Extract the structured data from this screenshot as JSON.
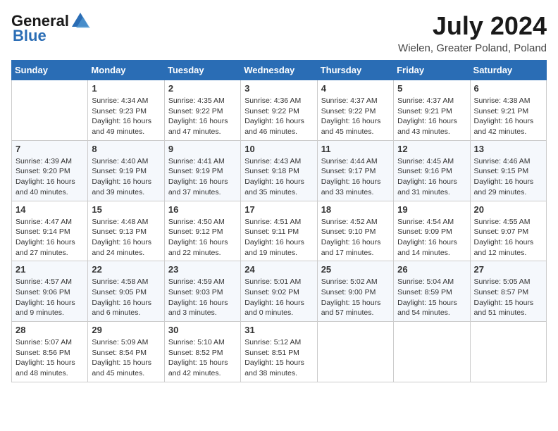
{
  "header": {
    "logo_general": "General",
    "logo_blue": "Blue",
    "month_year": "July 2024",
    "location": "Wielen, Greater Poland, Poland"
  },
  "weekdays": [
    "Sunday",
    "Monday",
    "Tuesday",
    "Wednesday",
    "Thursday",
    "Friday",
    "Saturday"
  ],
  "weeks": [
    [
      {
        "day": "",
        "content": ""
      },
      {
        "day": "1",
        "content": "Sunrise: 4:34 AM\nSunset: 9:23 PM\nDaylight: 16 hours\nand 49 minutes."
      },
      {
        "day": "2",
        "content": "Sunrise: 4:35 AM\nSunset: 9:22 PM\nDaylight: 16 hours\nand 47 minutes."
      },
      {
        "day": "3",
        "content": "Sunrise: 4:36 AM\nSunset: 9:22 PM\nDaylight: 16 hours\nand 46 minutes."
      },
      {
        "day": "4",
        "content": "Sunrise: 4:37 AM\nSunset: 9:22 PM\nDaylight: 16 hours\nand 45 minutes."
      },
      {
        "day": "5",
        "content": "Sunrise: 4:37 AM\nSunset: 9:21 PM\nDaylight: 16 hours\nand 43 minutes."
      },
      {
        "day": "6",
        "content": "Sunrise: 4:38 AM\nSunset: 9:21 PM\nDaylight: 16 hours\nand 42 minutes."
      }
    ],
    [
      {
        "day": "7",
        "content": "Sunrise: 4:39 AM\nSunset: 9:20 PM\nDaylight: 16 hours\nand 40 minutes."
      },
      {
        "day": "8",
        "content": "Sunrise: 4:40 AM\nSunset: 9:19 PM\nDaylight: 16 hours\nand 39 minutes."
      },
      {
        "day": "9",
        "content": "Sunrise: 4:41 AM\nSunset: 9:19 PM\nDaylight: 16 hours\nand 37 minutes."
      },
      {
        "day": "10",
        "content": "Sunrise: 4:43 AM\nSunset: 9:18 PM\nDaylight: 16 hours\nand 35 minutes."
      },
      {
        "day": "11",
        "content": "Sunrise: 4:44 AM\nSunset: 9:17 PM\nDaylight: 16 hours\nand 33 minutes."
      },
      {
        "day": "12",
        "content": "Sunrise: 4:45 AM\nSunset: 9:16 PM\nDaylight: 16 hours\nand 31 minutes."
      },
      {
        "day": "13",
        "content": "Sunrise: 4:46 AM\nSunset: 9:15 PM\nDaylight: 16 hours\nand 29 minutes."
      }
    ],
    [
      {
        "day": "14",
        "content": "Sunrise: 4:47 AM\nSunset: 9:14 PM\nDaylight: 16 hours\nand 27 minutes."
      },
      {
        "day": "15",
        "content": "Sunrise: 4:48 AM\nSunset: 9:13 PM\nDaylight: 16 hours\nand 24 minutes."
      },
      {
        "day": "16",
        "content": "Sunrise: 4:50 AM\nSunset: 9:12 PM\nDaylight: 16 hours\nand 22 minutes."
      },
      {
        "day": "17",
        "content": "Sunrise: 4:51 AM\nSunset: 9:11 PM\nDaylight: 16 hours\nand 19 minutes."
      },
      {
        "day": "18",
        "content": "Sunrise: 4:52 AM\nSunset: 9:10 PM\nDaylight: 16 hours\nand 17 minutes."
      },
      {
        "day": "19",
        "content": "Sunrise: 4:54 AM\nSunset: 9:09 PM\nDaylight: 16 hours\nand 14 minutes."
      },
      {
        "day": "20",
        "content": "Sunrise: 4:55 AM\nSunset: 9:07 PM\nDaylight: 16 hours\nand 12 minutes."
      }
    ],
    [
      {
        "day": "21",
        "content": "Sunrise: 4:57 AM\nSunset: 9:06 PM\nDaylight: 16 hours\nand 9 minutes."
      },
      {
        "day": "22",
        "content": "Sunrise: 4:58 AM\nSunset: 9:05 PM\nDaylight: 16 hours\nand 6 minutes."
      },
      {
        "day": "23",
        "content": "Sunrise: 4:59 AM\nSunset: 9:03 PM\nDaylight: 16 hours\nand 3 minutes."
      },
      {
        "day": "24",
        "content": "Sunrise: 5:01 AM\nSunset: 9:02 PM\nDaylight: 16 hours\nand 0 minutes."
      },
      {
        "day": "25",
        "content": "Sunrise: 5:02 AM\nSunset: 9:00 PM\nDaylight: 15 hours\nand 57 minutes."
      },
      {
        "day": "26",
        "content": "Sunrise: 5:04 AM\nSunset: 8:59 PM\nDaylight: 15 hours\nand 54 minutes."
      },
      {
        "day": "27",
        "content": "Sunrise: 5:05 AM\nSunset: 8:57 PM\nDaylight: 15 hours\nand 51 minutes."
      }
    ],
    [
      {
        "day": "28",
        "content": "Sunrise: 5:07 AM\nSunset: 8:56 PM\nDaylight: 15 hours\nand 48 minutes."
      },
      {
        "day": "29",
        "content": "Sunrise: 5:09 AM\nSunset: 8:54 PM\nDaylight: 15 hours\nand 45 minutes."
      },
      {
        "day": "30",
        "content": "Sunrise: 5:10 AM\nSunset: 8:52 PM\nDaylight: 15 hours\nand 42 minutes."
      },
      {
        "day": "31",
        "content": "Sunrise: 5:12 AM\nSunset: 8:51 PM\nDaylight: 15 hours\nand 38 minutes."
      },
      {
        "day": "",
        "content": ""
      },
      {
        "day": "",
        "content": ""
      },
      {
        "day": "",
        "content": ""
      }
    ]
  ]
}
